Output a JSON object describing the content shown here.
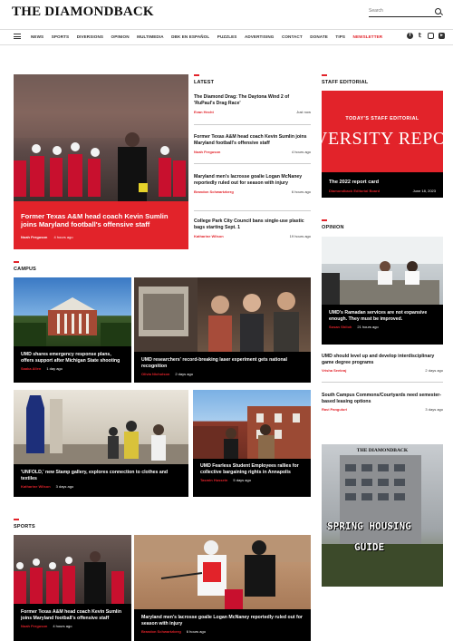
{
  "header": {
    "logo": "THE DIAMONDBACK",
    "search_placeholder": "Search"
  },
  "nav": {
    "items": [
      "NEWS",
      "SPORTS",
      "DIVERSIONS",
      "OPINION",
      "MULTIMEDIA",
      "DBK EN ESPAÑOL",
      "PUZZLES",
      "ADVERTISING",
      "CONTACT",
      "DONATE",
      "TIPS",
      "NEWSLETTER"
    ],
    "social": [
      "f",
      "t",
      "ig",
      "yt"
    ],
    "colors": {
      "accent": "#e2232a",
      "dark": "#000000"
    }
  },
  "featured": {
    "headline": "Former Texas A&M head coach Kevin Sumlin joins Maryland football's offensive staff",
    "author": "Noah Ferguson",
    "time": "4 hours ago"
  },
  "latest": {
    "label": "LATEST",
    "items": [
      {
        "headline": "The Diamond Drag: The Daytona Wind 2 of 'RuPaul's Drag Race'",
        "author": "Evan Hecht",
        "time": "Just now"
      },
      {
        "headline": "Former Texas A&M head coach Kevin Sumlin joins Maryland football's offensive staff",
        "author": "Noah Ferguson",
        "time": "4 hours ago"
      },
      {
        "headline": "Maryland men's lacrosse goalie Logan McNaney reportedly ruled out for season with injury",
        "author": "Brandon Schwartzberg",
        "time": "6 hours ago"
      },
      {
        "headline": "College Park City Council bans single-use plastic bags starting Sept. 1",
        "author": "Katharine Wilson",
        "time": "19 hours ago"
      }
    ]
  },
  "staff_editorial": {
    "label": "STAFF EDITORIAL",
    "banner_top": "TODAY'S STAFF EDITORIAL",
    "banner_main": "VERSITY REPORT CA",
    "headline": "The 2022 report card",
    "author": "Diamondback Editorial Board",
    "time": "June 18, 2023"
  },
  "opinion": {
    "label": "OPINION",
    "lead": {
      "headline": "UMD's Ramadan services are not expansive enough. They must be improved.",
      "author": "Sosan Shiloh",
      "time": "21 hours ago"
    },
    "items": [
      {
        "headline": "UMD should level up and develop interdisciplinary game degree programs",
        "author": "Vrisha Seekraj",
        "time": "2 days ago"
      },
      {
        "headline": "South Campus Commons/Courtyards need semester-based leasing options",
        "author": "Ravi Panguluri",
        "time": "3 days ago"
      }
    ]
  },
  "campus": {
    "label": "CAMPUS",
    "items": [
      {
        "headline": "UMD shares emergency response plans, offers support after Michigan State shooting",
        "author": "Saaka Allen",
        "time": "1 day ago"
      },
      {
        "headline": "UMD researchers' record-breaking laser experiment gets national recognition",
        "author": "Olivia Nicholson",
        "time": "2 days ago"
      },
      {
        "headline": "'UNFOLD,' new Stamp gallery, explores connection to clothes and textiles",
        "author": "Katharine Wilson",
        "time": "3 days ago"
      },
      {
        "headline": "UMD Fearless Student Employees rallies for collective bargaining rights in Annapolis",
        "author": "Tasmin Hussein",
        "time": "5 days ago"
      }
    ]
  },
  "sports": {
    "label": "SPORTS",
    "items": [
      {
        "headline": "Former Texas A&M head coach Kevin Sumlin joins Maryland football's offensive staff",
        "author": "Noah Ferguson",
        "time": "4 hours ago"
      },
      {
        "headline": "Maryland men's lacrosse goalie Logan McNaney reportedly ruled out for season with injury",
        "author": "Brandon Schwartzberg",
        "time": "6 hours ago"
      }
    ]
  },
  "ad": {
    "logo": "THE DIAMONDBACK",
    "line1": "SPRING HOUSING",
    "line2": "GUIDE"
  }
}
